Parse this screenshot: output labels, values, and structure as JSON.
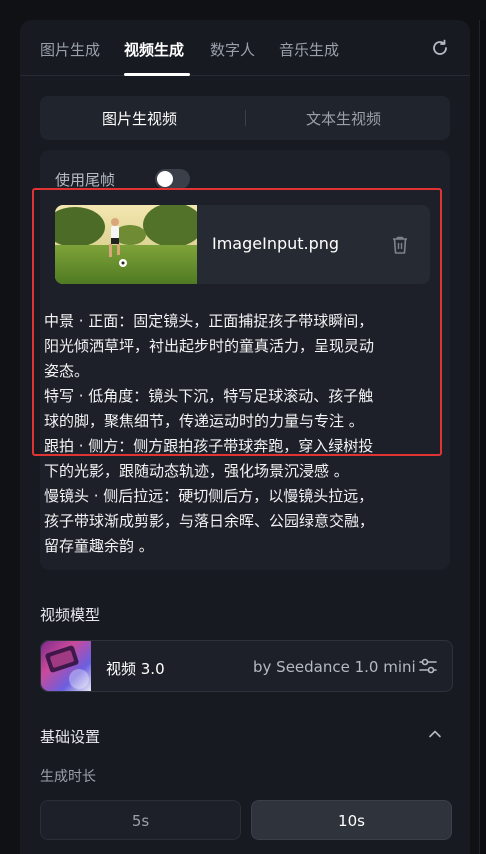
{
  "tabs": [
    "图片生成",
    "视频生成",
    "数字人",
    "音乐生成"
  ],
  "active_tab": "视频生成",
  "mode_switch": {
    "option_a": "图片生视频",
    "option_b": "文本生视频",
    "selected": "图片生视频"
  },
  "tail_frame": {
    "label": "使用尾帧",
    "enabled": false
  },
  "image_input": {
    "filename": "ImageInput.png"
  },
  "prompt_lines": [
    "中景 · 正面：固定镜头，正面捕捉孩子带球瞬间，",
    "阳光倾洒草坪，衬出起步时的童真活力，呈现灵动",
    "姿态。",
    "特写 · 低角度：镜头下沉，特写足球滚动、孩子触",
    "球的脚，聚焦细节，传递运动时的力量与专注 。",
    "跟拍 · 侧方：侧方跟拍孩子带球奔跑，穿入绿树投",
    "下的光影，跟随动态轨迹，强化场景沉浸感 。",
    "慢镜头 · 侧后拉远：硬切侧后方，以慢镜头拉远，",
    "孩子带球渐成剪影，与落日余晖、公园绿意交融，",
    "留存童趣余韵 。"
  ],
  "video_model": {
    "section_title": "视频模型",
    "name": "视频 3.0",
    "by": "by Seedance 1.0 mini"
  },
  "basic_settings": {
    "section_title": "基础设置",
    "duration_label": "生成时长",
    "options": [
      "5s",
      "10s"
    ],
    "selected": "10s"
  },
  "colors": {
    "accent_border": "#e03434",
    "panel": "#171a21",
    "background": "#0f1115"
  },
  "icons": [
    "refresh-icon",
    "trash-icon",
    "settings-sliders-icon",
    "chevron-up-icon"
  ]
}
